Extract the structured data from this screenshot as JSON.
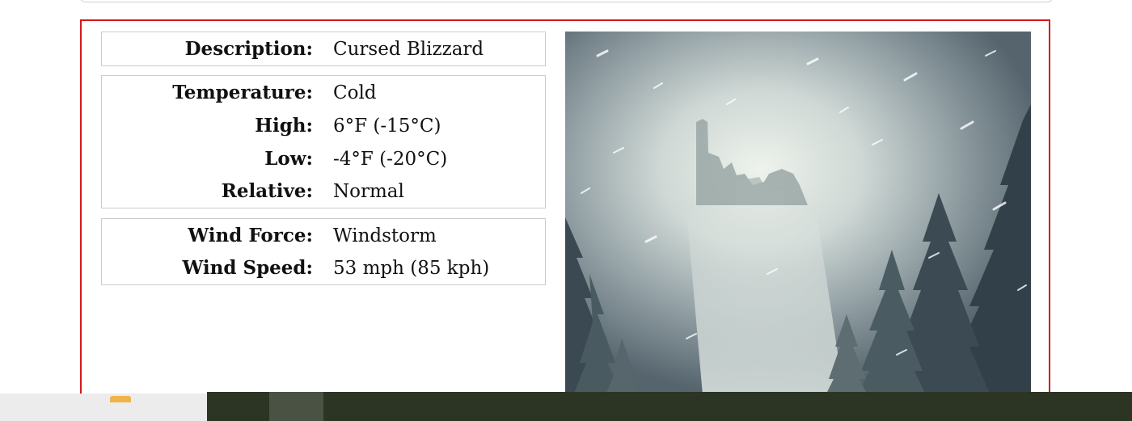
{
  "weather": {
    "description": {
      "label": "Description:",
      "value": "Cursed Blizzard"
    },
    "temperature": {
      "label": "Temperature:",
      "value": "Cold",
      "high_label": "High:",
      "high_value": "6°F (-15°C)",
      "low_label": "Low:",
      "low_value": "-4°F (-20°C)",
      "relative_label": "Relative:",
      "relative_value": "Normal"
    },
    "wind": {
      "force_label": "Wind Force:",
      "force_value": "Windstorm",
      "speed_label": "Wind Speed:",
      "speed_value": "53 mph (85 kph)"
    }
  },
  "image": {
    "subject": "snowy-ruined-castle-in-blizzard-illustration"
  }
}
